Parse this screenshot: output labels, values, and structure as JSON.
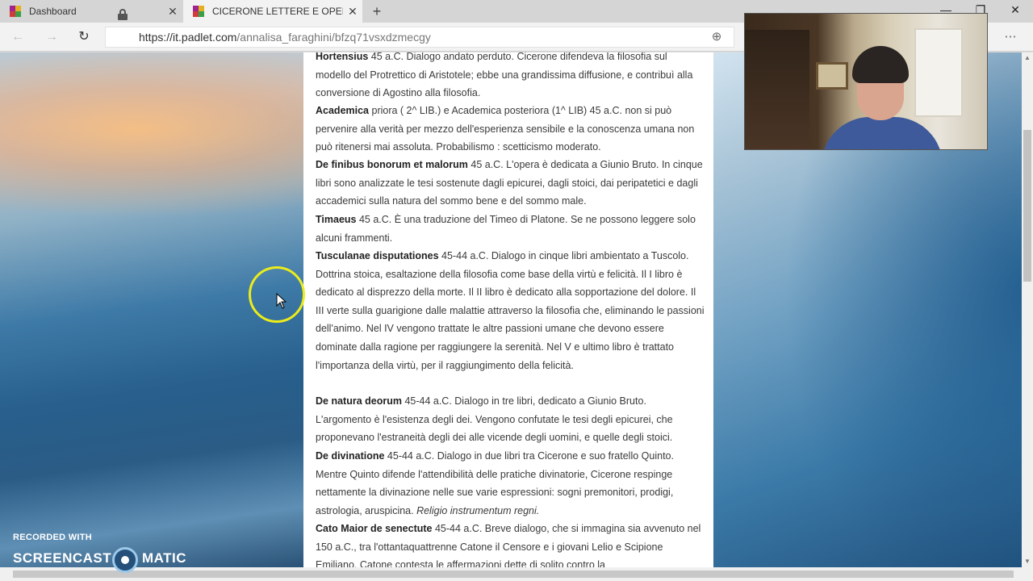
{
  "browser": {
    "tabs": [
      {
        "title": "Dashboard",
        "close": "✕"
      },
      {
        "title": "CICERONE LETTERE E OPERE FIL",
        "close": "✕"
      }
    ],
    "new_tab": "+",
    "window_controls": {
      "minimize": "—",
      "restore": "❐",
      "close": "✕"
    },
    "nav": {
      "back": "←",
      "forward": "→",
      "refresh": "↻"
    },
    "url_host": "https://it.padlet.com",
    "url_path": "/annalisa_faraghini/bfzq71vsxdzmecgy",
    "toolbar_icons": {
      "reading": "⊕",
      "favorite": "☆",
      "more": "⋯"
    }
  },
  "padlet_post": {
    "paragraphs": [
      {
        "title": "Hortensius",
        "body": "     45 a.C.   Dialogo andato perduto. Cicerone difendeva la filosofia sul modello del Protrettico di Aristotele; ebbe una grandissima diffusione, e contribuì alla conversione di Agostino alla filosofia."
      },
      {
        "title": "Academica",
        "body": " priora ( 2^ LIB.) e Academica posteriora (1^ LIB)     45 a.C.    non si può pervenire alla verità per mezzo dell'esperienza sensibile e la conoscenza umana non può ritenersi mai assoluta. Probabilismo : scetticismo moderato."
      },
      {
        "title": "De finibus bonorum et malorum",
        "body": "      45 a.C.    L'opera è dedicata  a Giunio Bruto. In cinque libri sono analizzate le tesi sostenute dagli epicurei, dagli stoici, dai peripatetici e dagli accademici sulla natura del sommo bene e del sommo male."
      },
      {
        "title": "Timaeus",
        "body": "        45 a.C.   È una traduzione del Timeo di Platone. Se ne possono leggere solo alcuni frammenti."
      },
      {
        "title": "Tusculanae disputationes",
        "body": "  45-44 a.C. Dialogo in cinque libri ambientato a Tuscolo. Dottrina stoica, esaltazione della filosofia come base della virtù e felicità. Il I libro è dedicato al disprezzo della morte. Il II libro è dedicato alla sopportazione del dolore.   Il III verte sulla guarigione dalle malattie attraverso la filosofia che, eliminando le passioni dell'animo. Nel IV vengono trattate le altre passioni umane che devono essere dominate dalla ragione per raggiungere la serenità. Nel V e ultimo libro è trattato l'importanza della virtù, per il raggiungimento della felicità."
      },
      {
        "title": "De natura deorum",
        "body": "       45-44 a.C.      Dialogo in tre libri, dedicato a Giunio Bruto. L'argomento è l'esistenza degli dei. Vengono confutate le tesi degli epicurei, che proponevano l'estraneità degli dei alle vicende degli uomini, e quelle degli stoici."
      },
      {
        "title": "De divinatione",
        "body": "      45-44 a.C.      Dialogo in due libri tra Cicerone e suo fratello Quinto. Mentre Quinto difende l'attendibilità delle pratiche divinatorie, Cicerone respinge nettamente la divinazione nelle sue varie espressioni: sogni premonitori, prodigi, astrologia, aruspicina. ",
        "italic": "Religio instrumentum regni."
      },
      {
        "title": "Cato Maior de senectute",
        "body": "   45-44 a.C.      Breve dialogo, che si immagina sia avvenuto nel 150 a.C., tra l'ottantaquattrenne Catone il Censore e i giovani Lelio e Scipione Emiliano. Catone contesta le affermazioni dette di solito contro la"
      }
    ]
  },
  "scrollbar": {
    "up": "▲",
    "down": "▼"
  },
  "watermark": {
    "line1": "RECORDED WITH",
    "left": "SCREENCAST",
    "right": "MATIC"
  }
}
